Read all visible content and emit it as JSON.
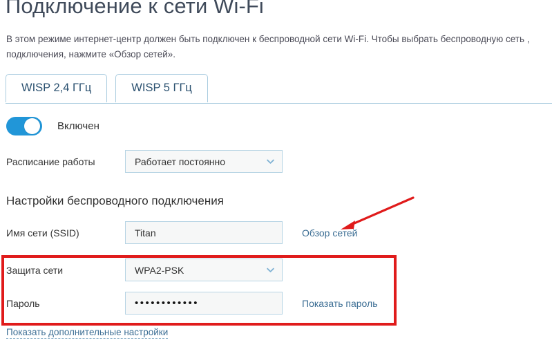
{
  "page": {
    "title": "Подключение к сети Wi-Fi",
    "description": "В этом режиме интернет-центр должен быть подключен к беспроводной сети Wi-Fi. Чтобы выбрать беспроводную сеть ,\nподключения, нажмите «Обзор сетей»."
  },
  "tabs": [
    {
      "label": "WISP 2,4 ГГц",
      "active": true
    },
    {
      "label": "WISP 5 ГГц",
      "active": false
    }
  ],
  "toggle": {
    "label": "Включен",
    "state": "on",
    "color": "#2196d8"
  },
  "schedule": {
    "label": "Расписание работы",
    "value": "Работает постоянно",
    "icon": "chevron-down-icon"
  },
  "section": {
    "heading": "Настройки беспроводного подключения"
  },
  "ssid": {
    "label": "Имя сети (SSID)",
    "value": "Titan",
    "placeholder": "",
    "link": "Обзор сетей"
  },
  "security": {
    "label": "Защита сети",
    "value": "WPA2-PSK",
    "icon": "chevron-down-icon"
  },
  "password": {
    "label": "Пароль",
    "value": "••••••••••••",
    "link": "Показать пароль"
  },
  "footer": {
    "more_settings_link": "Показать дополнительные настройки"
  },
  "annotations": {
    "highlight_color": "#e01b1b",
    "box_target": "security-and-password-rows",
    "arrow_target": "browse-networks-link"
  }
}
